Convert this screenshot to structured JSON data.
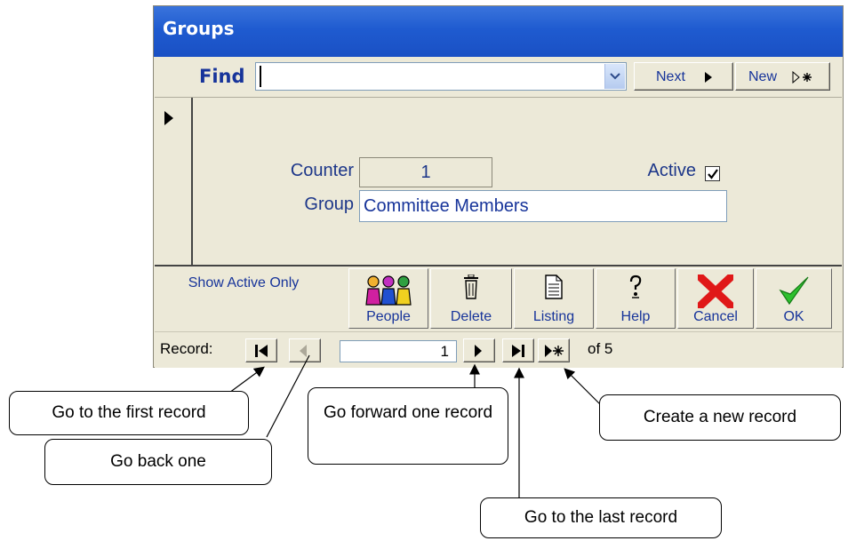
{
  "window": {
    "title": "Groups",
    "find": {
      "label": "Find",
      "value": "",
      "next_label": "Next",
      "new_label": "New"
    },
    "fields": {
      "counter_label": "Counter",
      "counter_value": "1",
      "group_label": "Group",
      "group_value": "Committee Members",
      "active_label": "Active",
      "active_checked": true
    },
    "toolbar": {
      "show_active": "Show Active Only",
      "people": "People",
      "delete": "Delete",
      "listing": "Listing",
      "help": "Help",
      "cancel": "Cancel",
      "ok": "OK"
    },
    "nav": {
      "record_label": "Record:",
      "current": "1",
      "of_text": "of 5"
    }
  },
  "callouts": {
    "first": "Go to the first record",
    "back": "Go back one",
    "forward": "Go forward one record",
    "last": "Go to the last record",
    "new": "Create a new record"
  },
  "colors": {
    "title_bar": "#1f5bd0",
    "form_bg": "#ece9d8",
    "label_text": "#1c3689"
  },
  "icons": [
    "dropdown-arrow-icon",
    "record-selector-icon",
    "people-icon",
    "trash-icon",
    "document-icon",
    "help-icon",
    "cancel-x-icon",
    "ok-check-icon",
    "first-record-icon",
    "prev-record-icon",
    "next-record-icon",
    "last-record-icon",
    "new-record-icon"
  ]
}
